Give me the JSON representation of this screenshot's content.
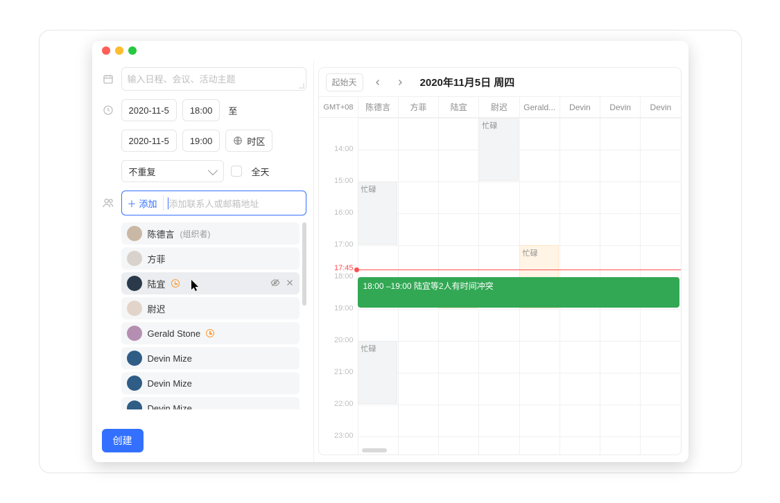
{
  "title_placeholder": "输入日程、会议、活动主题",
  "date": {
    "start_date": "2020-11-5",
    "start_time": "18:00",
    "to_label": "至",
    "end_date": "2020-11-5",
    "end_time": "19:00",
    "tz_label": "时区",
    "repeat": "不重复",
    "allday_label": "全天"
  },
  "invitees": {
    "add_label": "添加",
    "placeholder": "添加联系人或邮箱地址",
    "list": [
      {
        "name": "陈德言",
        "suffix": "(组织者)",
        "avatar_bg": "#c9b8a6",
        "conflict": false,
        "hover": false
      },
      {
        "name": "方菲",
        "suffix": "",
        "avatar_bg": "#d9d2cc",
        "conflict": false,
        "hover": false
      },
      {
        "name": "陆宜",
        "suffix": "",
        "avatar_bg": "#2b3a4a",
        "conflict": true,
        "hover": true
      },
      {
        "name": "尉迟",
        "suffix": "",
        "avatar_bg": "#e2d4c8",
        "conflict": false,
        "hover": false
      },
      {
        "name": "Gerald Stone",
        "suffix": "",
        "avatar_bg": "#b58fb1",
        "conflict": true,
        "hover": false
      },
      {
        "name": "Devin Mize",
        "suffix": "",
        "avatar_bg": "#2f5d86",
        "conflict": false,
        "hover": false
      },
      {
        "name": "Devin Mize",
        "suffix": "",
        "avatar_bg": "#2f5d86",
        "conflict": false,
        "hover": false
      },
      {
        "name": "Devin Mize",
        "suffix": "",
        "avatar_bg": "#2f5d86",
        "conflict": false,
        "hover": false
      }
    ]
  },
  "create_label": "创建",
  "schedule": {
    "today_label": "起始天",
    "date_title": "2020年11月5日 周四",
    "tz": "GMT+08",
    "columns": [
      "陈德言",
      "方菲",
      "陆宜",
      "尉迟",
      "Gerald...",
      "Devin",
      "Devin",
      "Devin"
    ],
    "hours": [
      "14:00",
      "15:00",
      "16:00",
      "17:00",
      "17:45",
      "18:00",
      "19:00",
      "20:00",
      "21:00",
      "22:00",
      "23:00"
    ],
    "now_label": "17:45",
    "busy_text": "忙碌",
    "event_text": "18:00 –19:00 陆宜等2人有时间冲突"
  }
}
